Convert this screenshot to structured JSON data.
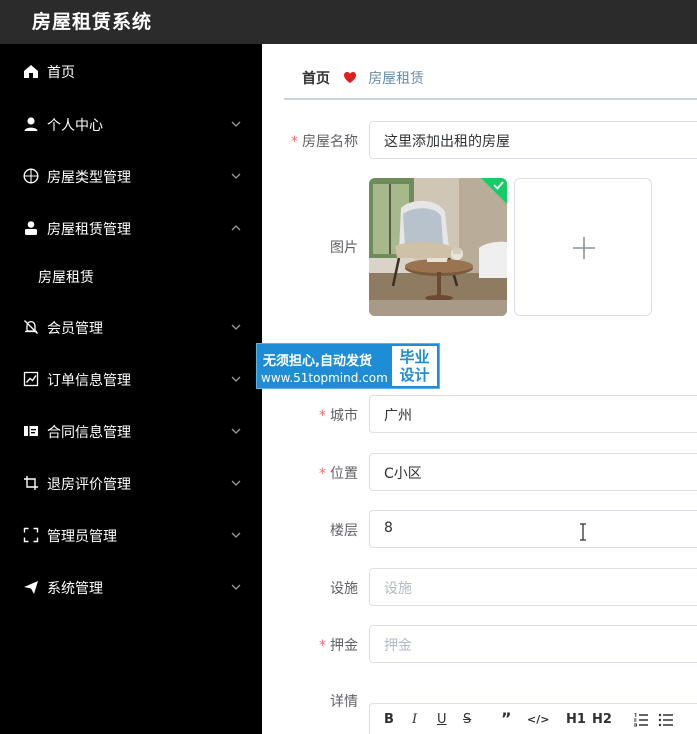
{
  "app": {
    "title": "房屋租赁系统"
  },
  "sidebar": {
    "items": [
      {
        "label": "首页",
        "icon": "home-icon",
        "has_chevron": false
      },
      {
        "label": "个人中心",
        "icon": "user-icon",
        "has_chevron": true,
        "chevron": "down"
      },
      {
        "label": "房屋类型管理",
        "icon": "compass-icon",
        "has_chevron": true,
        "chevron": "down"
      },
      {
        "label": "房屋租赁管理",
        "icon": "person-icon",
        "has_chevron": true,
        "chevron": "up"
      },
      {
        "label": "房屋租赁",
        "submenu": true
      },
      {
        "label": "会员管理",
        "icon": "bell-off-icon",
        "has_chevron": true,
        "chevron": "down"
      },
      {
        "label": "订单信息管理",
        "icon": "chart-icon",
        "has_chevron": true,
        "chevron": "down"
      },
      {
        "label": "合同信息管理",
        "icon": "ticket-icon",
        "has_chevron": true,
        "chevron": "down"
      },
      {
        "label": "退房评价管理",
        "icon": "crop-icon",
        "has_chevron": true,
        "chevron": "down"
      },
      {
        "label": "管理员管理",
        "icon": "fullscreen-icon",
        "has_chevron": true,
        "chevron": "down"
      },
      {
        "label": "系统管理",
        "icon": "send-icon",
        "has_chevron": true,
        "chevron": "down"
      }
    ]
  },
  "breadcrumb": {
    "home": "首页",
    "current": "房屋租赁"
  },
  "form": {
    "required_mark": "*",
    "house_name": {
      "label": "房屋名称",
      "value": "这里添加出租的房屋",
      "required": true
    },
    "image": {
      "label": "图片",
      "uploaded_count": 1
    },
    "city": {
      "label": "城市",
      "value": "广州",
      "required": true
    },
    "location": {
      "label": "位置",
      "value": "C小区",
      "required": true
    },
    "floor": {
      "label": "楼层",
      "value": "8",
      "required": false
    },
    "facilities": {
      "label": "设施",
      "placeholder": "设施",
      "required": false
    },
    "deposit": {
      "label": "押金",
      "placeholder": "押金",
      "required": true
    },
    "details": {
      "label": "详情",
      "required": false
    }
  },
  "editor_toolbar": {
    "bold": "B",
    "italic": "I",
    "underline": "U",
    "strike": "S",
    "quote": "”",
    "code": "</>",
    "h1": "H1",
    "h2": "H2"
  },
  "watermark": {
    "line1": "无须担心,自动发货",
    "line2": "www.51topmind.com",
    "box_line1": "毕业",
    "box_line2": "设计"
  },
  "colors": {
    "topbar": "#2b2b2b",
    "sidebar": "#000000",
    "required": "#f56c6c",
    "heart": "#e02020",
    "success_badge": "#13ce66",
    "watermark": "#1f8dd6"
  }
}
